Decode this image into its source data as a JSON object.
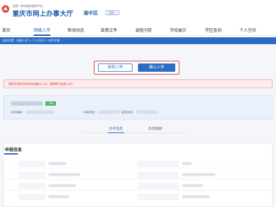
{
  "header": {
    "sub_title": "全国一体化政务服务平台",
    "main_title": "重庆市网上办事大厅",
    "district": "渝中区",
    "district_switch": "切换 ∨"
  },
  "nav": {
    "items": [
      {
        "label": "首页"
      },
      {
        "label": "网络入学"
      },
      {
        "label": "新闻动态"
      },
      {
        "label": "政策文件"
      },
      {
        "label": "调查问卷"
      },
      {
        "label": "学校展示"
      },
      {
        "label": "学区查询"
      },
      {
        "label": "个人空间"
      }
    ]
  },
  "breadcrumb": "当前位置：网络入学 > 个人空间 > 办件详情",
  "actions": {
    "cancel_label": "放弃入学",
    "confirm_label": "确认入学"
  },
  "alert": {
    "text": "请您在规定时间内完成确认入学，逾期视为放弃入学！"
  },
  "info_card": {
    "status": "已确认",
    "applicant_no_label": "办件编码：",
    "school_label": "申请学校：",
    "registered_school_label": "报到学校："
  },
  "tabs": [
    {
      "label": "办件信息"
    },
    {
      "label": "办件流转"
    }
  ],
  "section": {
    "title": "申报信息"
  },
  "colors": {
    "brand": "#1e5fb0",
    "primary": "#2b6cc4",
    "alert": "#d9363e",
    "highlight_border": "#e0464a"
  }
}
